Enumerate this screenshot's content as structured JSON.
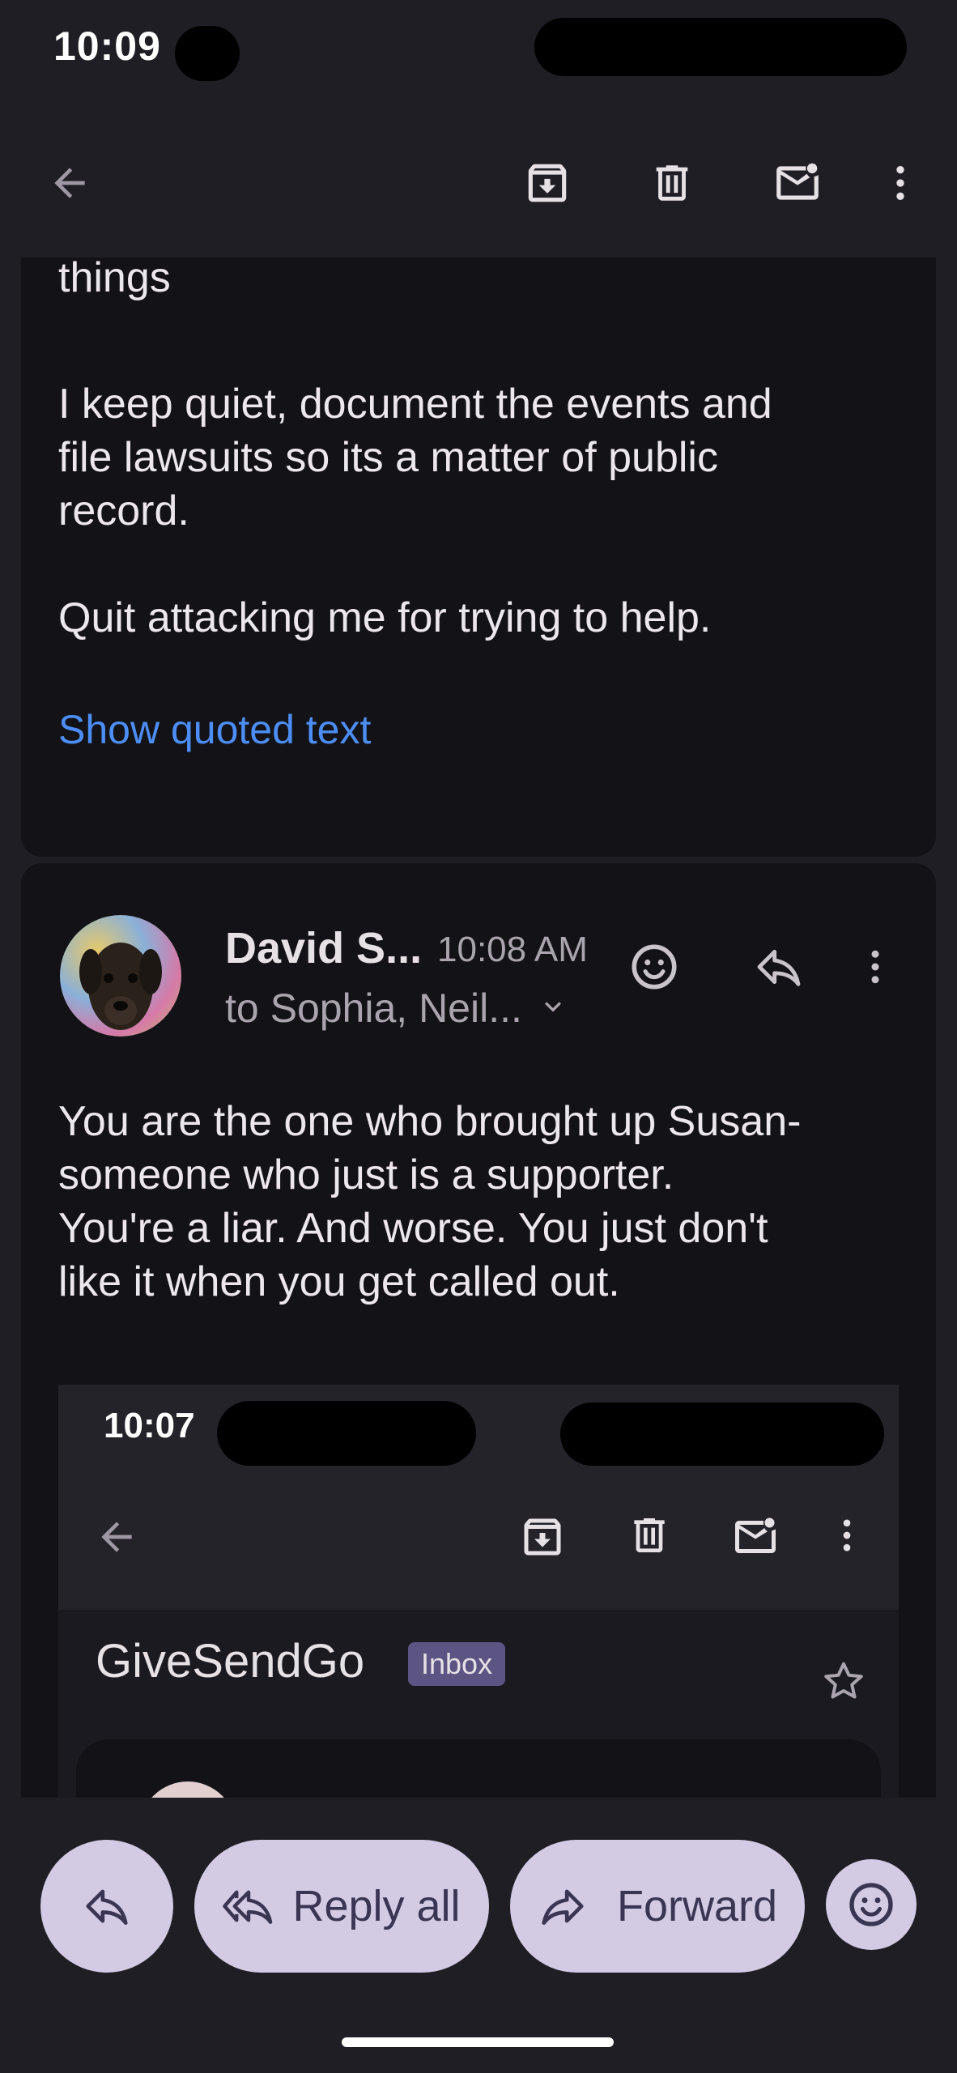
{
  "status_bar": {
    "time": "10:09"
  },
  "toolbar": {
    "back": "back-arrow-icon",
    "archive": "archive-icon",
    "delete": "trash-icon",
    "mark_unread": "mark-unread-icon",
    "more": "more-vert-icon"
  },
  "message1": {
    "partial_line": "things",
    "paragraph1": "I keep quiet, document the events and\nfile lawsuits so its a matter of public\nrecord.",
    "paragraph2": "Quit attacking me for trying to help.",
    "show_quoted": "Show quoted text"
  },
  "message2": {
    "sender": "David S...",
    "time": "10:08 AM",
    "recipients": "to Sophia, Neil...",
    "paragraph1": "You are the one who brought up Susan-\nsomeone who just is a supporter.",
    "paragraph2": "You're a liar. And worse. You just don't\nlike it when you get called out."
  },
  "embedded_screenshot": {
    "time": "10:07",
    "subject": "GiveSendGo",
    "label": "Inbox"
  },
  "actions": {
    "reply_all": "Reply all",
    "forward": "Forward"
  },
  "colors": {
    "background": "#1e1e24",
    "card": "#131317",
    "link": "#4c8ef5",
    "pill": "#d3cbe4",
    "inbox_badge": "#5c5583"
  }
}
